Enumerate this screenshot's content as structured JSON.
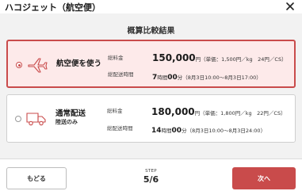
{
  "header": {
    "title": "ハコジェット（航空便）",
    "close_icon": "close-icon"
  },
  "section_title": "概算比較結果",
  "options": [
    {
      "label": "航空便を使う",
      "sub": "",
      "selected": true,
      "icon": "airplane-icon",
      "fee_label": "総料金",
      "fee_value": "150,000",
      "fee_unit": "円",
      "fee_detail": "（単価：1,500円／kg　24円／CS）",
      "time_label": "総配送時間",
      "time_hours": "7",
      "time_h_unit": "時間",
      "time_minutes": "00",
      "time_m_unit": "分",
      "time_detail": "（8月3日10:00〜8月3日17:00）"
    },
    {
      "label": "通常配送",
      "sub": "陸送のみ",
      "selected": false,
      "icon": "truck-icon",
      "fee_label": "総料金",
      "fee_value": "180,000",
      "fee_unit": "円",
      "fee_detail": "（単価：1,800円／kg　22円／CS）",
      "time_label": "総配送時間",
      "time_hours": "14",
      "time_h_unit": "時間",
      "time_minutes": "00",
      "time_m_unit": "分",
      "time_detail": "（8月3日10:00〜8月3日24:00）"
    }
  ],
  "footer": {
    "back_label": "もどる",
    "step_label": "STEP",
    "step_value": "5/6",
    "next_label": "次へ"
  },
  "colors": {
    "accent": "#c94b4b",
    "selected_bg": "#fdeaea"
  }
}
